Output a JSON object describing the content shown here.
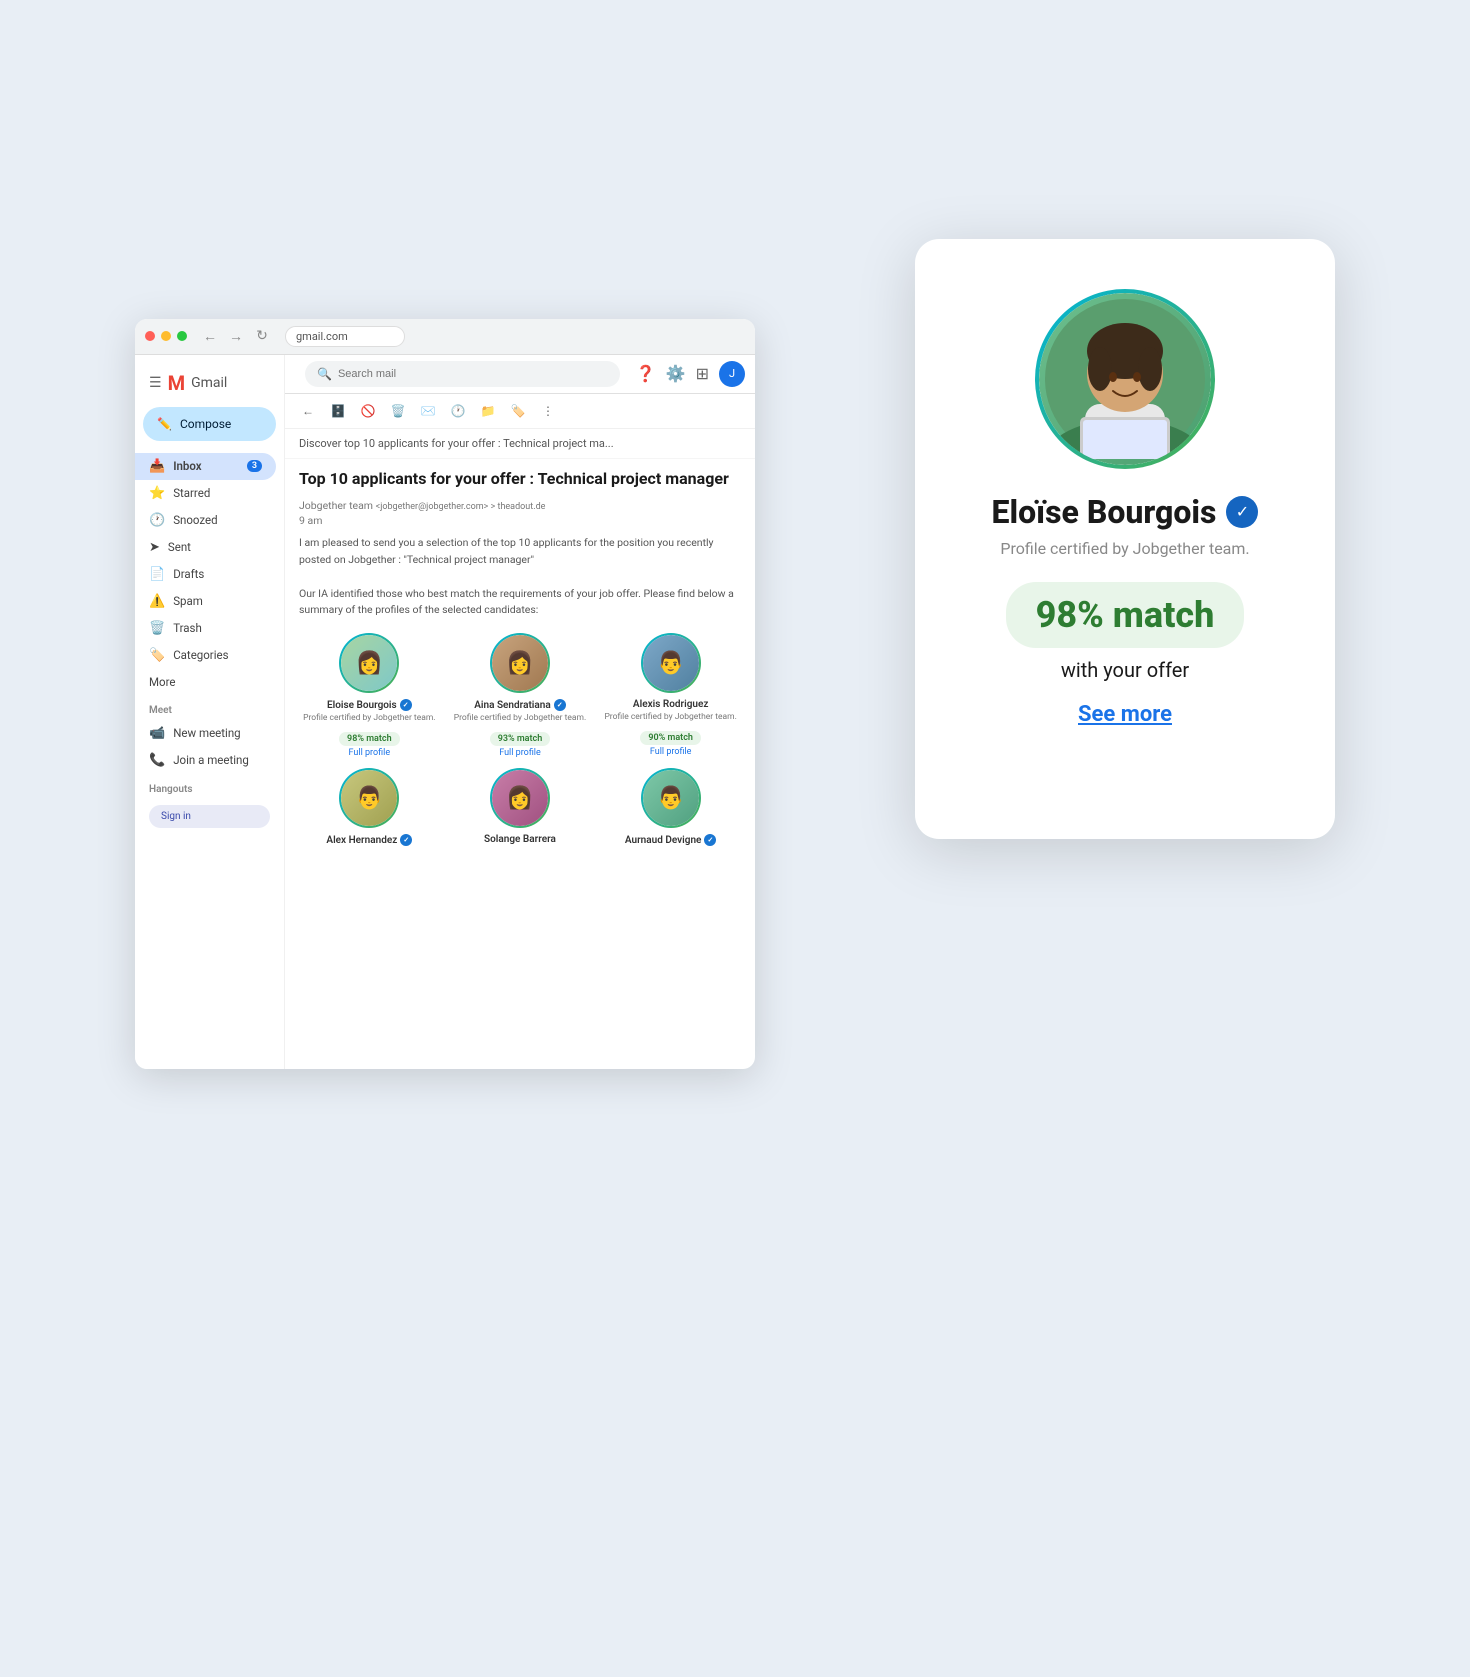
{
  "browser": {
    "address": "gmail.com",
    "dots": [
      "red",
      "yellow",
      "green"
    ]
  },
  "gmail": {
    "logo": "Gmail",
    "search_placeholder": "Search mail",
    "compose_label": "Compose",
    "sidebar_items": [
      {
        "label": "Inbox",
        "icon": "📥",
        "badge": "3",
        "active": true
      },
      {
        "label": "Starred",
        "icon": "⭐",
        "badge": "",
        "active": false
      },
      {
        "label": "Snoozed",
        "icon": "🕐",
        "badge": "",
        "active": false
      },
      {
        "label": "Sent",
        "icon": "📤",
        "badge": "",
        "active": false
      },
      {
        "label": "Drafts",
        "icon": "📄",
        "badge": "",
        "active": false
      },
      {
        "label": "Spam",
        "icon": "⚠️",
        "badge": "",
        "active": false
      },
      {
        "label": "Trash",
        "icon": "🗑️",
        "badge": "",
        "active": false
      },
      {
        "label": "Categories",
        "icon": "🏷️",
        "badge": "",
        "active": false
      },
      {
        "label": "More",
        "icon": "",
        "badge": "",
        "active": false
      }
    ],
    "meet_section": "Meet",
    "meet_items": [
      "New meeting",
      "Join a meeting"
    ],
    "hangouts_section": "Hangouts",
    "email_subject_bar": "Discover top 10 applicants for your offer : Technical project ma...",
    "email_from": "Jobgether team <jobgether@jobgether.com> > theadout.de",
    "email_time": "9 am",
    "email_title": "Top 10 applicants for your offer : Technical project manager",
    "email_body_1": "I am pleased to send you a selection of the top 10 applicants for the position you recently posted on Jobgether : \"Technical project manager\"",
    "email_body_2": "Our IA identified those who best match the requirements of your job offer. Please find below a summary of the profiles of the selected candidates:",
    "candidates": [
      {
        "name": "Eloise Bourgois",
        "verified": true,
        "cert": "Profile certified by Jobgether team.",
        "match": "98% match",
        "avatar_color": "eloise",
        "emoji": "👩"
      },
      {
        "name": "Aina Sendratiana",
        "verified": true,
        "cert": "Profile certified by Jobgether team.",
        "match": "93% match",
        "avatar_color": "aina",
        "emoji": "👩"
      },
      {
        "name": "Alexis Rodriguez",
        "verified": false,
        "cert": "Profile certified by Jobgether team.",
        "match": "90% match",
        "avatar_color": "alexis",
        "emoji": "👨"
      },
      {
        "name": "Alex Hernandez",
        "verified": true,
        "cert": "",
        "match": "",
        "avatar_color": "alex",
        "emoji": "👨"
      },
      {
        "name": "Solange Barrera",
        "verified": false,
        "cert": "",
        "match": "",
        "avatar_color": "solange",
        "emoji": "👩"
      },
      {
        "name": "Aurnaud Devigne",
        "verified": true,
        "cert": "",
        "match": "",
        "avatar_color": "aurnaud",
        "emoji": "👨"
      }
    ],
    "full_profile_label": "Full profile"
  },
  "profile_card": {
    "name": "Eloïse Bourgois",
    "cert_text": "Profile certified by Jobgether team.",
    "match_percent": "98% match",
    "match_subtitle": "with your offer",
    "see_more": "See more",
    "verified_icon": "✓"
  }
}
